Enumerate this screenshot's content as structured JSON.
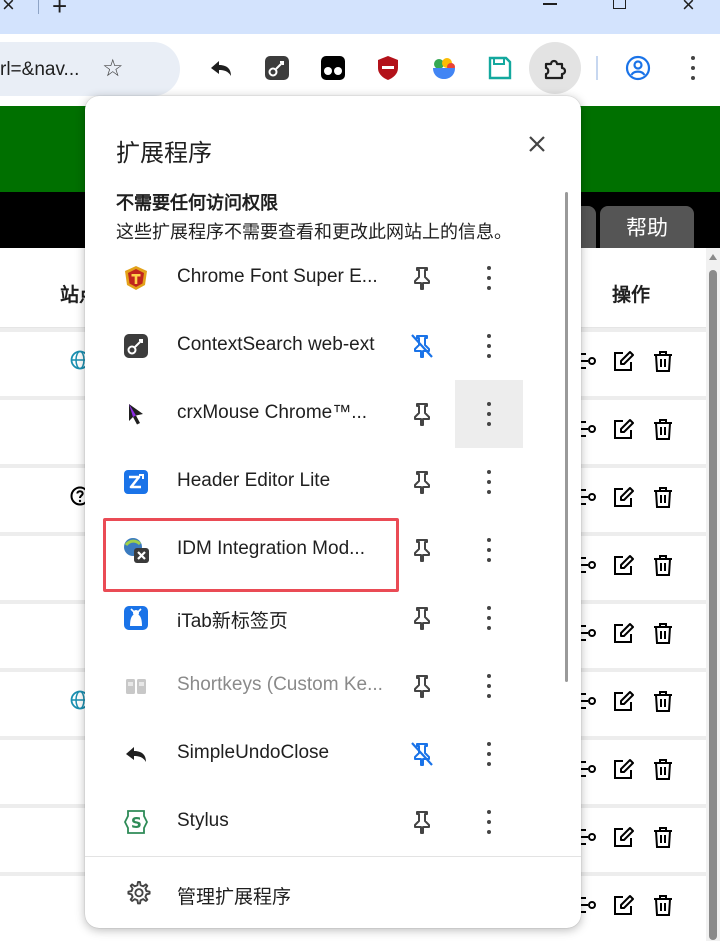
{
  "browser": {
    "omnibox_text": "rl=&nav...",
    "toolbar_icons": [
      "undo-close-extension-icon",
      "context-search-icon",
      "tampermonkey-icon",
      "shield-extension-icon",
      "bowl-extension-icon",
      "save-extension-icon",
      "extensions-puzzle-icon",
      "profile-icon",
      "chrome-menu-icon"
    ]
  },
  "page": {
    "tab_help": "帮助",
    "col_site": "站点",
    "col_ops": "操作"
  },
  "popup": {
    "title": "扩展程序",
    "section_title": "不需要任何访问权限",
    "section_desc": "这些扩展程序不需要查看和更改此网站上的信息。",
    "extensions": [
      {
        "name": "Chrome Font Super E...",
        "icon": "font-super-icon",
        "pinned": false,
        "dim": false
      },
      {
        "name": "ContextSearch web-ext",
        "icon": "context-search-icon",
        "pinned": true,
        "dim": false
      },
      {
        "name": "crxMouse Chrome™...",
        "icon": "crxmouse-icon",
        "pinned": false,
        "dim": false
      },
      {
        "name": "Header Editor Lite",
        "icon": "header-editor-icon",
        "pinned": false,
        "dim": false
      },
      {
        "name": "IDM Integration Mod...",
        "icon": "idm-icon",
        "pinned": false,
        "dim": false
      },
      {
        "name": "iTab新标签页",
        "icon": "itab-icon",
        "pinned": false,
        "dim": false
      },
      {
        "name": "Shortkeys (Custom Ke...",
        "icon": "shortkeys-icon",
        "pinned": false,
        "dim": true
      },
      {
        "name": "SimpleUndoClose",
        "icon": "undo-close-icon",
        "pinned": true,
        "dim": false
      },
      {
        "name": "Stylus",
        "icon": "stylus-icon",
        "pinned": false,
        "dim": false
      }
    ],
    "manage_label": "管理扩展程序"
  },
  "colors": {
    "accent_blue": "#1a73e8",
    "highlight_red": "#ea4b55",
    "page_green": "#007000"
  }
}
